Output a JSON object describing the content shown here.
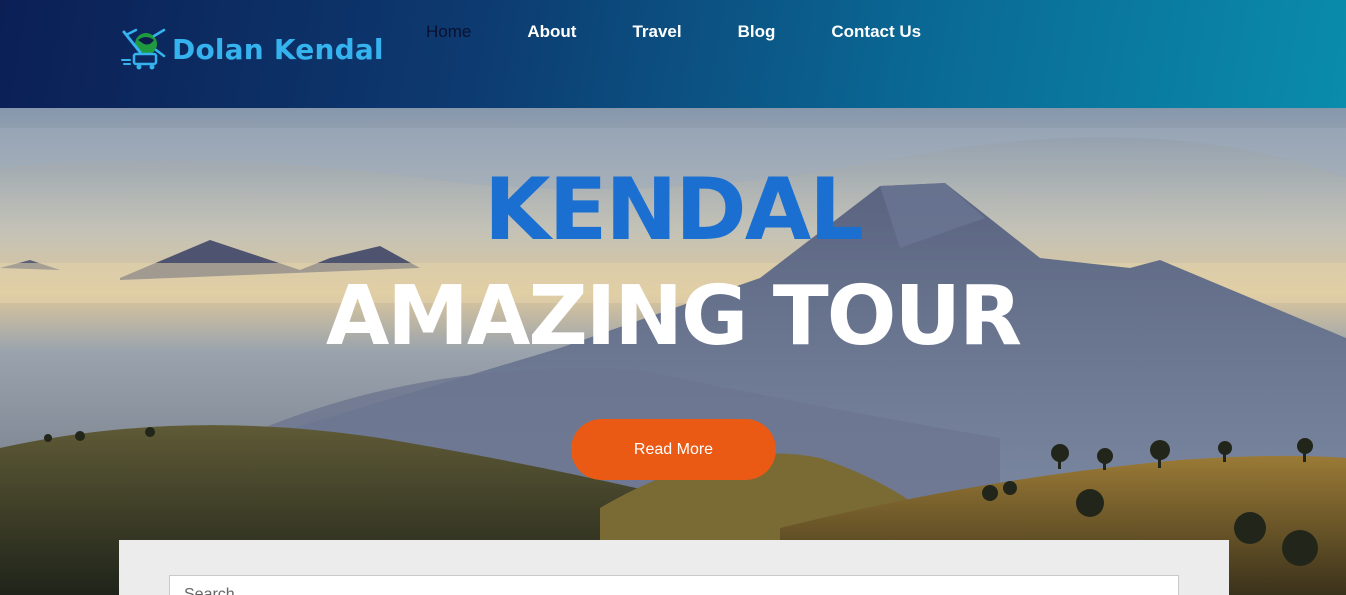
{
  "header": {
    "logo_text": "Dolan Kendal",
    "logo_icon": "travel-globe-icon",
    "nav": [
      {
        "label": "Home",
        "active": true
      },
      {
        "label": "About",
        "active": false
      },
      {
        "label": "Travel",
        "active": false
      },
      {
        "label": "Blog",
        "active": false
      },
      {
        "label": "Contact Us",
        "active": false
      }
    ]
  },
  "hero": {
    "title_line1": "KENDAL",
    "title_line2": "AMAZING TOUR",
    "cta_label": "Read More"
  },
  "search": {
    "placeholder": "Search"
  },
  "colors": {
    "header_start": "#0b1f55",
    "header_end": "#0a8cac",
    "logo": "#35b3ee",
    "title_blue": "#1a6fd1",
    "cta": "#ea5a14"
  }
}
